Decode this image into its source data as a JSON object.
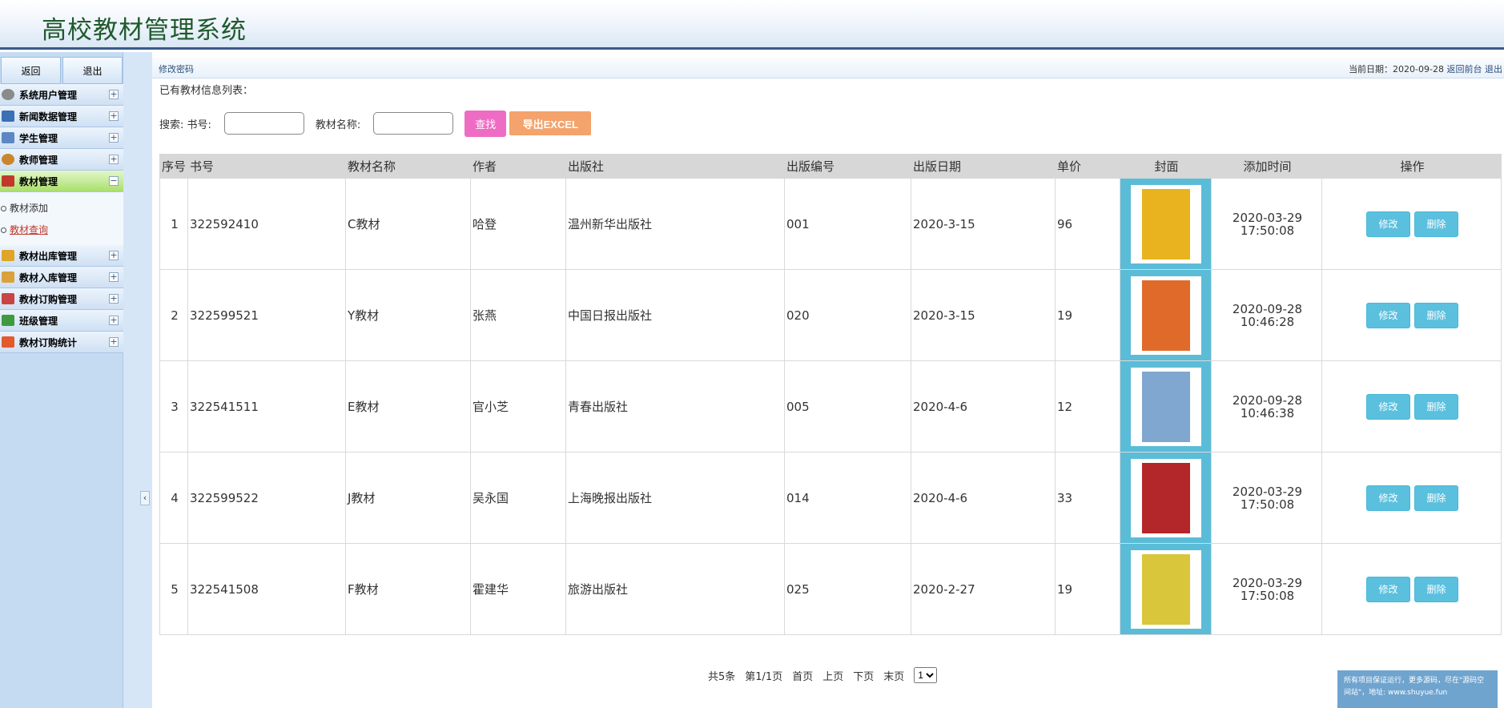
{
  "app": {
    "title": "高校教材管理系统"
  },
  "sidebar": {
    "buttons": [
      "返回",
      "退出"
    ],
    "menu": [
      {
        "label": "系统用户管理",
        "icon": "gear-icon",
        "color": "#8a8a8a"
      },
      {
        "label": "新闻数据管理",
        "icon": "monitor-icon",
        "color": "#3b6fb6"
      },
      {
        "label": "学生管理",
        "icon": "calendar-icon",
        "color": "#5c87c2"
      },
      {
        "label": "教师管理",
        "icon": "user-icon",
        "color": "#c9862c"
      },
      {
        "label": "教材管理",
        "icon": "book-icon",
        "color": "#c0392b"
      }
    ],
    "submenu": [
      {
        "label": "教材添加"
      },
      {
        "label": "教材查询"
      }
    ],
    "menu2": [
      {
        "label": "教材出库管理",
        "icon": "folder-icon",
        "color": "#e0a526"
      },
      {
        "label": "教材入库管理",
        "icon": "box-icon",
        "color": "#d9a23a"
      },
      {
        "label": "教材订购管理",
        "icon": "chart-icon",
        "color": "#c94444"
      },
      {
        "label": "班级管理",
        "icon": "list-icon",
        "color": "#3f9a3f"
      },
      {
        "label": "教材订购统计",
        "icon": "stats-icon",
        "color": "#e35b2d"
      }
    ]
  },
  "topline": {
    "left": "修改密码",
    "date_label": "当前日期：2020-09-28",
    "back": "返回前台",
    "logout": "退出"
  },
  "list_title": "已有教材信息列表：",
  "search": {
    "label": "搜索: 书号:",
    "name_label": "教材名称:",
    "find": "查找",
    "export": "导出EXCEL"
  },
  "table": {
    "headers": [
      "序号",
      "书号",
      "教材名称",
      "作者",
      "出版社",
      "出版编号",
      "出版日期",
      "单价",
      "封面",
      "添加时间",
      "操作"
    ],
    "rows": [
      {
        "idx": "1",
        "isbn": "322592410",
        "name": "C教材",
        "author": "哈登",
        "publisher": "温州新华出版社",
        "pubno": "001",
        "pubdate": "2020-3-15",
        "price": "96",
        "cover_color": "#e8b31e",
        "time": "2020-03-29\n17:50:08"
      },
      {
        "idx": "2",
        "isbn": "322599521",
        "name": "Y教材",
        "author": "张燕",
        "publisher": "中国日报出版社",
        "pubno": "020",
        "pubdate": "2020-3-15",
        "price": "19",
        "cover_color": "#e06a2a",
        "time": "2020-09-28\n10:46:28"
      },
      {
        "idx": "3",
        "isbn": "322541511",
        "name": "E教材",
        "author": "官小芝",
        "publisher": "青春出版社",
        "pubno": "005",
        "pubdate": "2020-4-6",
        "price": "12",
        "cover_color": "#7fa7cf",
        "time": "2020-09-28\n10:46:38"
      },
      {
        "idx": "4",
        "isbn": "322599522",
        "name": "J教材",
        "author": "吴永国",
        "publisher": "上海晚报出版社",
        "pubno": "014",
        "pubdate": "2020-4-6",
        "price": "33",
        "cover_color": "#b3262a",
        "time": "2020-03-29\n17:50:08"
      },
      {
        "idx": "5",
        "isbn": "322541508",
        "name": "F教材",
        "author": "霍建华",
        "publisher": "旅游出版社",
        "pubno": "025",
        "pubdate": "2020-2-27",
        "price": "19",
        "cover_color": "#d9c63a",
        "time": "2020-03-29\n17:50:08"
      }
    ],
    "edit": "修改",
    "delete": "删除"
  },
  "pager": {
    "total": "共5条",
    "page": "第1/1页",
    "first": "首页",
    "prev": "上页",
    "next": "下页",
    "last": "末页",
    "selected": "1"
  },
  "watermark": "所有项目保证运行，更多源码，尽在\"源码空间站\"，地址: www.shuyue.fun"
}
